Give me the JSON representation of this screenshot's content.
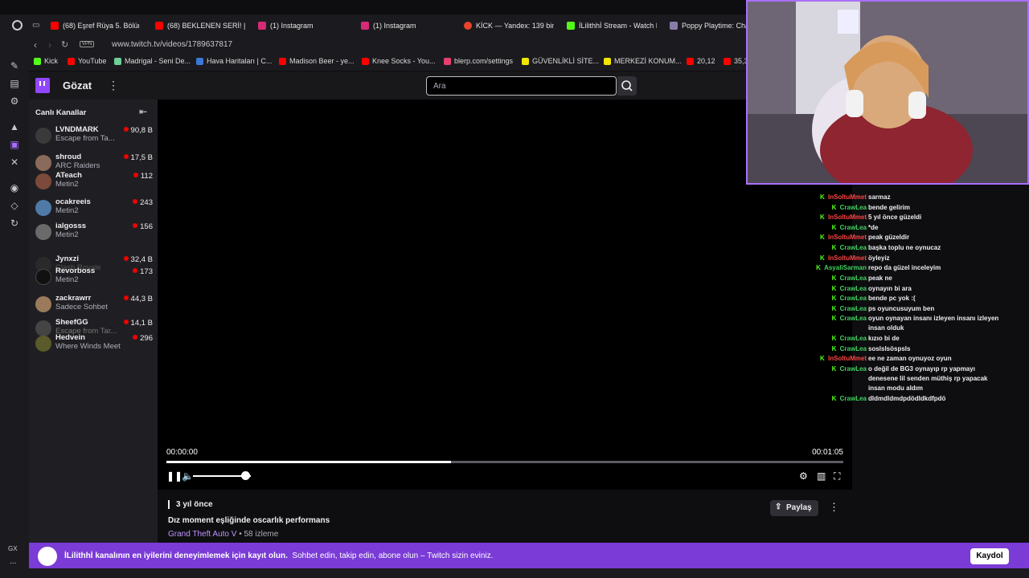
{
  "browser": {
    "tabs": [
      {
        "label": "(68) Eşref Rüya 5. Bölüm",
        "favicon": "youtube-icon",
        "color": "#ff0000"
      },
      {
        "label": "(68) BEKLENEN SERİ! | P",
        "favicon": "youtube-icon",
        "color": "#ff0000"
      },
      {
        "label": "(1) Instagram",
        "favicon": "instagram-icon",
        "color": "#d62976"
      },
      {
        "label": "(1) Instagram",
        "favicon": "instagram-icon",
        "color": "#d62976"
      },
      {
        "label": "KİCK — Yandex: 139 bin",
        "favicon": "yandex-icon",
        "color": "#e8452c"
      },
      {
        "label": "İLilithhİ Stream - Watch L",
        "favicon": "kick-icon",
        "color": "#53fc18"
      },
      {
        "label": "Poppy Playtime: Cha",
        "favicon": "game-icon",
        "color": "#8a7ca8"
      }
    ],
    "vpn_label": "VPN",
    "url": "www.twitch.tv/videos/1789637817",
    "bookmarks": [
      {
        "label": "Kick",
        "color": "#53fc18"
      },
      {
        "label": "YouTube",
        "color": "#ff0000"
      },
      {
        "label": "Madrigal - Seni De...",
        "color": "#6fcf97"
      },
      {
        "label": "Hava Haritaları | C...",
        "color": "#3c78d8"
      },
      {
        "label": "Madison Beer - ye...",
        "color": "#ff0000"
      },
      {
        "label": "Knee Socks - You...",
        "color": "#ff0000"
      },
      {
        "label": "blerp.com/settings",
        "color": "#e83f6f"
      },
      {
        "label": "GÜVENLİKLİ SİTE...",
        "color": "#f2e600"
      },
      {
        "label": "MERKEZİ KONUM...",
        "color": "#f2e600"
      },
      {
        "label": "20,12",
        "color": "#ff0000"
      },
      {
        "label": "35,3",
        "color": "#ff0000"
      }
    ]
  },
  "header": {
    "browse_label": "Gözat",
    "search_placeholder": "Ara"
  },
  "sidebar": {
    "title": "Canlı Kanallar",
    "channels": [
      {
        "name": "LVNDMARK",
        "game": "Escape from Ta...",
        "viewers": "90,8 B"
      },
      {
        "name": "shroud",
        "game": "ARC Raiders",
        "viewers": "17,5 B"
      },
      {
        "name": "ATeach",
        "game": "Metin2",
        "viewers": "112"
      },
      {
        "name": "ocakreeis",
        "game": "Metin2",
        "viewers": "243"
      },
      {
        "name": "ialgosss",
        "game": "Metin2",
        "viewers": "156"
      },
      {
        "name": "Jynxzi",
        "game": "Clash Royale",
        "viewers": "32,4 B"
      },
      {
        "name": "Revorboss",
        "game": "Metin2",
        "viewers": "173"
      },
      {
        "name": "zackrawrr",
        "game": "Sadece Sohbet",
        "viewers": "44,3 B"
      },
      {
        "name": "SheefGG",
        "game": "Escape from Tar...",
        "viewers": "14,1 B"
      },
      {
        "name": "Hedvein",
        "game": "Where Winds Meet",
        "viewers": "296"
      }
    ]
  },
  "player": {
    "current_time": "00:00:00",
    "duration": "00:01:05",
    "progress_fraction": 0.42,
    "volume_fraction": 0.9
  },
  "video": {
    "ago": "3 yıl önce",
    "title": "Dız moment eşliğinde oscarlık performans",
    "game": "Grand Theft Auto V",
    "views": " • 58 izleme",
    "share_label": "Paylaş"
  },
  "chat": {
    "messages": [
      {
        "user": "lnSoltuMmet",
        "text": "sarmaz",
        "color": "#ff4545"
      },
      {
        "user": "CrawLea",
        "text": "bende gelirim",
        "color": "#41d35f"
      },
      {
        "user": "lnSoltuMmet",
        "text": "5 yıl önce güzeldi",
        "color": "#ff4545"
      },
      {
        "user": "CrawLea",
        "text": "*de",
        "color": "#41d35f"
      },
      {
        "user": "lnSoltuMmet",
        "text": "peak güzeldir",
        "color": "#ff4545"
      },
      {
        "user": "CrawLea",
        "text": "başka toplu ne oynucaz",
        "color": "#41d35f"
      },
      {
        "user": "lnSoltuMmet",
        "text": "öyleyiz",
        "color": "#ff4545"
      },
      {
        "user": "AsyaliSarman",
        "text": "repo da güzel inceleyim",
        "color": "#41d35f"
      },
      {
        "user": "CrawLea",
        "text": "peak ne",
        "color": "#41d35f"
      },
      {
        "user": "CrawLea",
        "text": "oynayın bi ara",
        "color": "#41d35f"
      },
      {
        "user": "CrawLea",
        "text": "bende pc yok :(",
        "color": "#41d35f"
      },
      {
        "user": "CrawLea",
        "text": "ps oyuncusuyum ben",
        "color": "#41d35f"
      },
      {
        "user": "CrawLea",
        "text": "oyun oynayan insanı izleyen insanı izleyen",
        "text2": "insan olduk",
        "color": "#41d35f"
      },
      {
        "user": "CrawLea",
        "text": "kızıo bi de",
        "color": "#41d35f"
      },
      {
        "user": "CrawLea",
        "text": "soslslsöspsls",
        "color": "#41d35f"
      },
      {
        "user": "lnSoltuMmet",
        "text": "ee ne zaman oynuyoz oyun",
        "color": "#ff4545"
      },
      {
        "user": "CrawLea",
        "text": "o değil de BG3 oynayıp rp yapmayı",
        "text2": "denesene lil senden müthiş rp yapacak",
        "text3": "insan modu aldım",
        "color": "#41d35f"
      },
      {
        "user": "CrawLea",
        "text": "dldmdldmdpdödldkdfpdö",
        "color": "#41d35f"
      }
    ]
  },
  "banner": {
    "bold_text": "İLilithhİ kanalının en iyilerini deneyimlemek için kayıt olun.",
    "text": "Sohbet edin, takip edin, abone olun – Twitch sizin eviniz.",
    "signup_label": "Kaydol"
  },
  "opera": {
    "gx_label": "GX",
    "dots_label": "..."
  },
  "colors": {
    "twitch_purple": "#9147ff",
    "banner_purple": "#7a3bd6",
    "live_red": "#eb0400"
  }
}
